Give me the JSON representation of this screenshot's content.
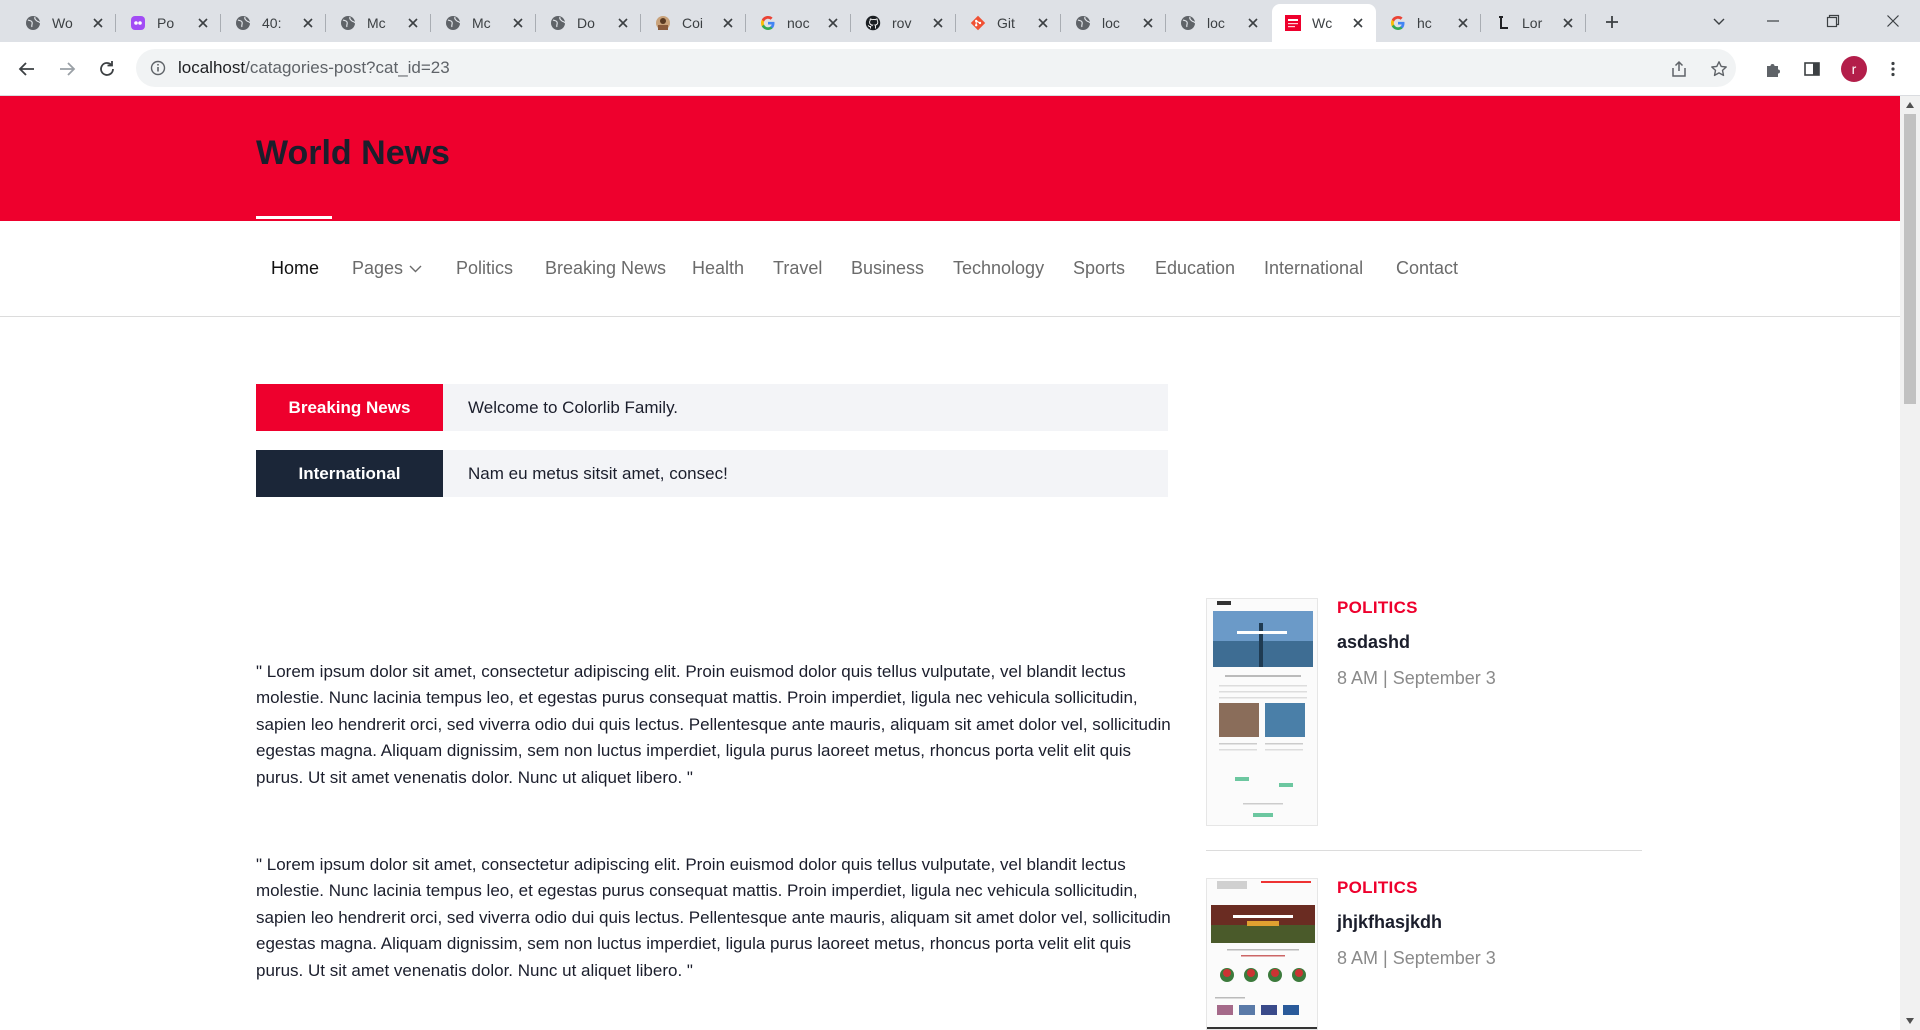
{
  "browser": {
    "tabs": [
      {
        "title": "Wo",
        "icon": "globe-icon",
        "active": false
      },
      {
        "title": "Po",
        "icon": "app-icon",
        "active": false
      },
      {
        "title": "40:",
        "icon": "globe-icon",
        "active": false
      },
      {
        "title": "Mc",
        "icon": "globe-icon",
        "active": false
      },
      {
        "title": "Mc",
        "icon": "globe-icon",
        "active": false
      },
      {
        "title": "Do",
        "icon": "globe-icon",
        "active": false
      },
      {
        "title": "Coi",
        "icon": "avatar-icon",
        "active": false
      },
      {
        "title": "noc",
        "icon": "google-icon",
        "active": false
      },
      {
        "title": "rov",
        "icon": "github-icon",
        "active": false
      },
      {
        "title": "Git",
        "icon": "git-icon",
        "active": false
      },
      {
        "title": "loc",
        "icon": "globe-icon",
        "active": false
      },
      {
        "title": "loc",
        "icon": "globe-icon",
        "active": false
      },
      {
        "title": "Wc",
        "icon": "newspaper-icon",
        "active": true
      },
      {
        "title": "hc",
        "icon": "google-icon",
        "active": false
      },
      {
        "title": "Lor",
        "icon": "lorem-icon",
        "active": false
      }
    ],
    "url_host": "localhost",
    "url_path": "/catagories-post?cat_id=23",
    "profile_initial": "r"
  },
  "site": {
    "title": "World News",
    "nav": [
      "Home",
      "Pages",
      "Politics",
      "Breaking News",
      "Health",
      "Travel",
      "Business",
      "Technology",
      "Sports",
      "Education",
      "International",
      "Contact"
    ],
    "active_nav": "Home",
    "brand_color": "#ee002d",
    "dark_color": "#1b1e2c"
  },
  "tickers": [
    {
      "label": "Breaking News",
      "text": "Welcome to Colorlib Family.",
      "color": "#ee002d"
    },
    {
      "label": "International",
      "text": "Nam eu metus sitsit amet, consec!",
      "color": "#1b2638"
    }
  ],
  "article": {
    "paragraphs": [
      "\" Lorem ipsum dolor sit amet, consectetur adipiscing elit. Proin euismod dolor quis tellus vulputate, vel blandit lectus molestie. Nunc lacinia tempus leo, et egestas purus consequat mattis. Proin imperdiet, ligula nec vehicula sollicitudin, sapien leo hendrerit orci, sed viverra odio dui quis lectus. Pellentesque ante mauris, aliquam sit amet dolor vel, sollicitudin egestas magna. Aliquam dignissim, sem non luctus imperdiet, ligula purus laoreet metus, rhoncus porta velit elit quis purus. Ut sit amet venenatis dolor. Nunc ut aliquet libero. \"",
      "\" Lorem ipsum dolor sit amet, consectetur adipiscing elit. Proin euismod dolor quis tellus vulputate, vel blandit lectus molestie. Nunc lacinia tempus leo, et egestas purus consequat mattis. Proin imperdiet, ligula nec vehicula sollicitudin, sapien leo hendrerit orci, sed viverra odio dui quis lectus. Pellentesque ante mauris, aliquam sit amet dolor vel, sollicitudin egestas magna. Aliquam dignissim, sem non luctus imperdiet, ligula purus laoreet metus, rhoncus porta velit elit quis purus. Ut sit amet venenatis dolor. Nunc ut aliquet libero. \""
    ]
  },
  "sidebar": {
    "posts": [
      {
        "category": "POLITICS",
        "title": "asdashd",
        "meta": "8 AM | September 3"
      },
      {
        "category": "POLITICS",
        "title": "jhjkfhasjkdh",
        "meta": "8 AM | September 3"
      }
    ]
  }
}
